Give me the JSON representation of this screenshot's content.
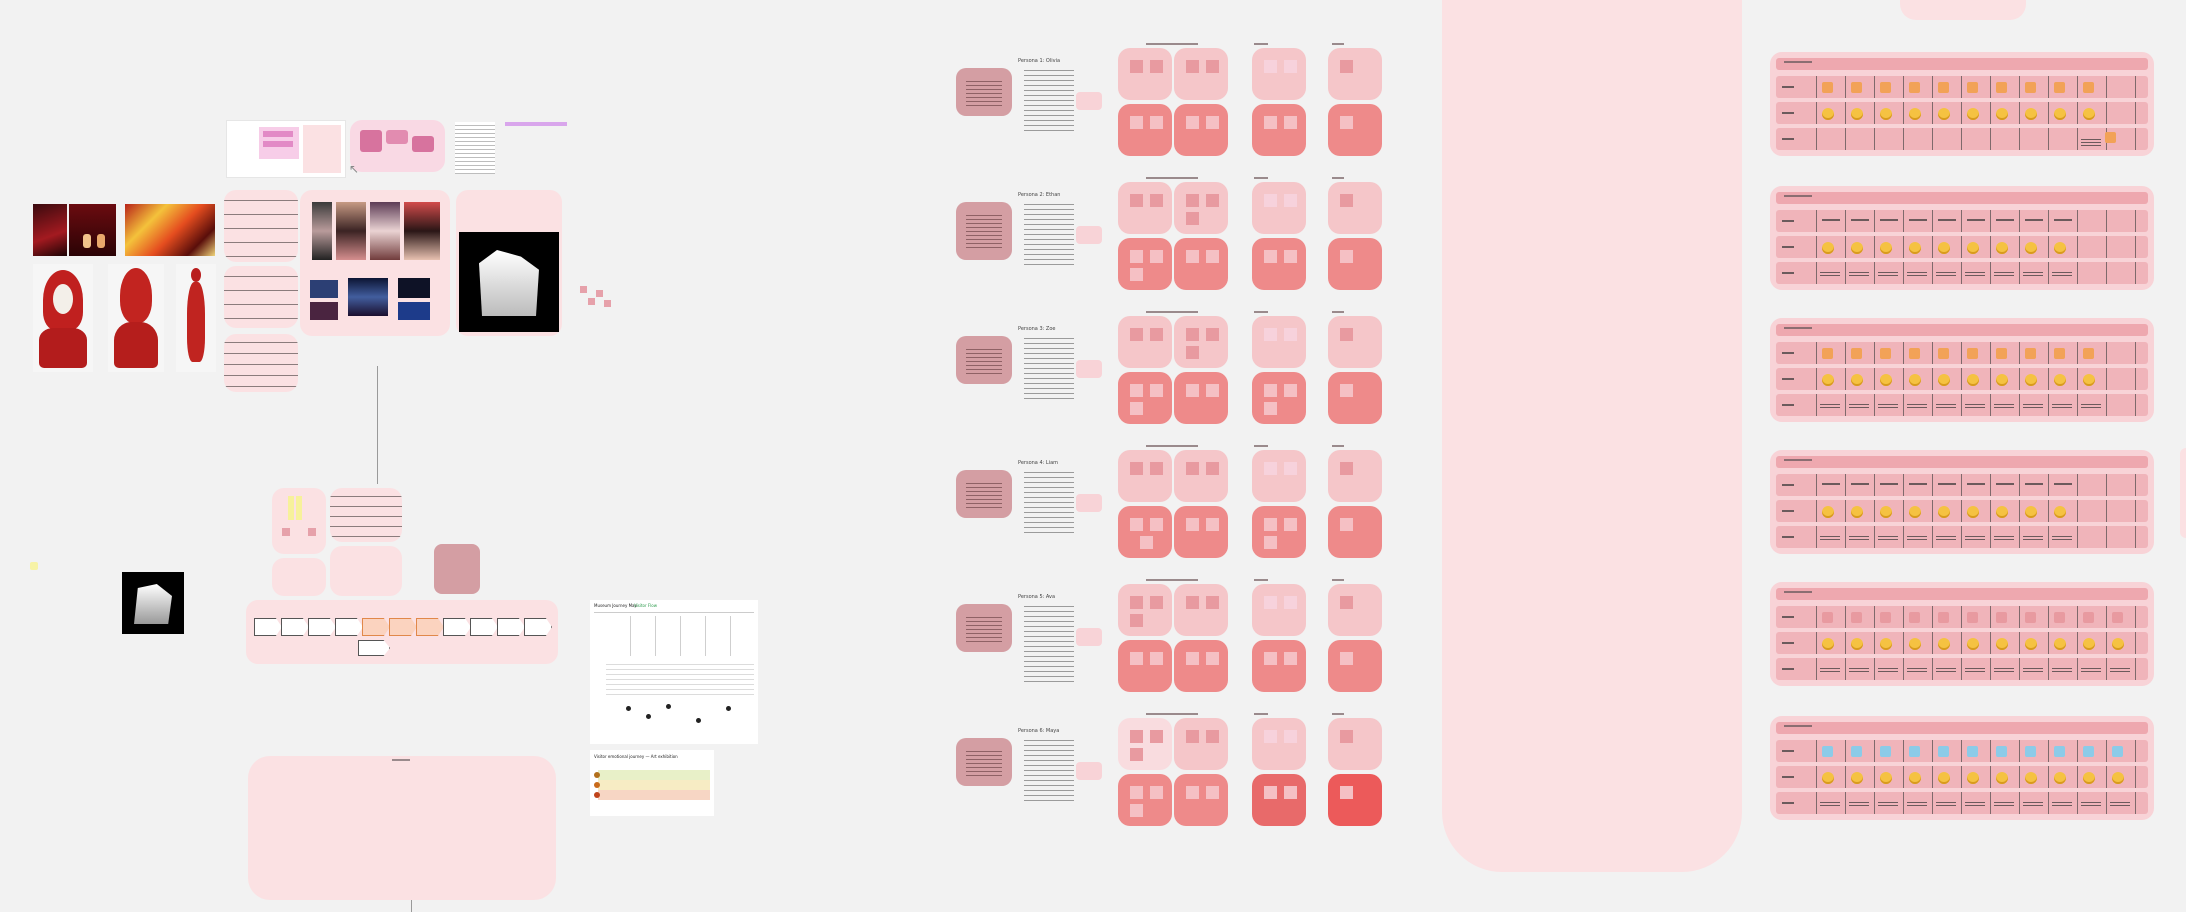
{
  "canvas": {
    "background": "#f2f2f2",
    "accent_pink": "#fbe1e3",
    "card_light": "#f5c6c9",
    "card_dark": "#ee8a8a"
  },
  "personas": [
    {
      "name": "Persona 1: Olivia"
    },
    {
      "name": "Persona 2: Ethan"
    },
    {
      "name": "Persona 3: Zoe"
    },
    {
      "name": "Persona 4: Liam"
    },
    {
      "name": "Persona 5: Ava"
    },
    {
      "name": "Persona 6: Maya"
    }
  ],
  "journey_map": {
    "title": "Museum Journey Map",
    "subtitle": "Visitor Flow"
  },
  "small_chart": {
    "title": "Visitor emotional journey — Art exhibition"
  },
  "icons": [
    "cursor-icon",
    "sticky-note-icon",
    "emoji-icon",
    "arrow-icon"
  ]
}
